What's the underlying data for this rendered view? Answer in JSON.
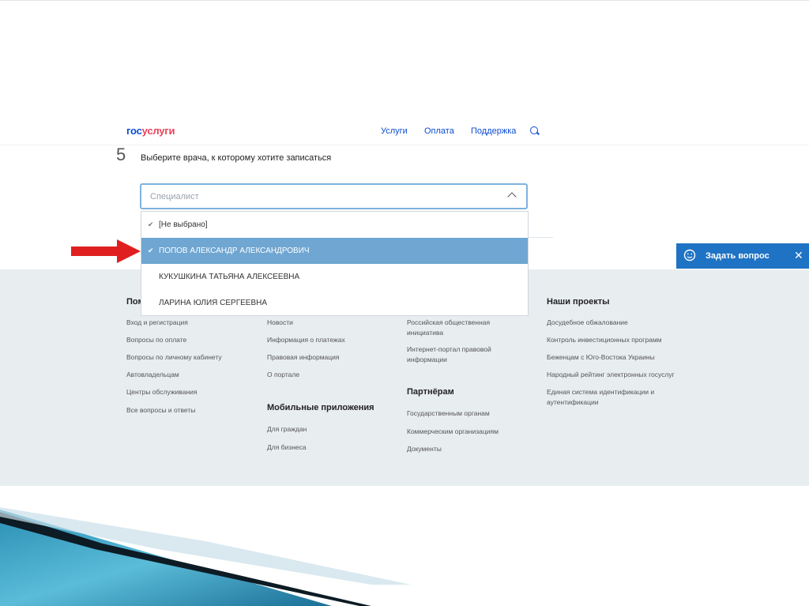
{
  "header": {
    "logo_part1": "гос",
    "logo_part2": "услуги",
    "nav": [
      "Услуги",
      "Оплата",
      "Поддержка"
    ]
  },
  "step": {
    "number": "5",
    "title": "Выберите врача, к которому хотите записаться"
  },
  "select": {
    "placeholder": "Специалист",
    "options": [
      {
        "label": "[Не выбрано]",
        "checked": true
      },
      {
        "label": "ПОПОВ АЛЕКСАНДР АЛЕКСАНДРОВИЧ",
        "checked": true,
        "selected": true
      },
      {
        "label": "КУКУШКИНА ТАТЬЯНА АЛЕКСЕЕВНА",
        "checked": false
      },
      {
        "label": "ЛАРИНА ЮЛИЯ СЕРГЕЕВНА",
        "checked": false
      }
    ]
  },
  "ask_widget": {
    "label": "Задать вопрос",
    "close": "✕"
  },
  "footer": {
    "col1": {
      "heading": "Пом",
      "links": [
        "Вход и регистрация",
        "Вопросы по оплате",
        "Вопросы по личному кабинету",
        "Автовладельцам",
        "Центры обслуживания",
        "Все вопросы и ответы"
      ]
    },
    "col2": {
      "links": [
        "Новости",
        "Информация о платежах",
        "Правовая информация",
        "О портале"
      ],
      "heading2": "Мобильные приложения",
      "links2": [
        "Для граждан",
        "Для бизнеса"
      ]
    },
    "col3": {
      "links": [
        "Российская общественная",
        "инициатива",
        "Интернет-портал правовой",
        "информации"
      ],
      "heading2": "Партнёрам",
      "links2": [
        "Государственным органам",
        "Коммерческим организациям",
        "Документы"
      ]
    },
    "col4": {
      "heading": "Наши проекты",
      "links": [
        "Досудебное обжалование",
        "Контроль инвестиционных программ",
        "Беженцам с Юго-Востока Украины",
        "Народный рейтинг электронных госуслуг",
        "Единая система идентификации и",
        "аутентификации"
      ]
    }
  },
  "colors": {
    "brand_blue": "#0d4cd3",
    "brand_red": "#ee3f58",
    "selected_option": "#6fa6d2",
    "ask_widget": "#1f73c4",
    "arrow": "#e02020",
    "footer_bg": "#e8edf0"
  }
}
